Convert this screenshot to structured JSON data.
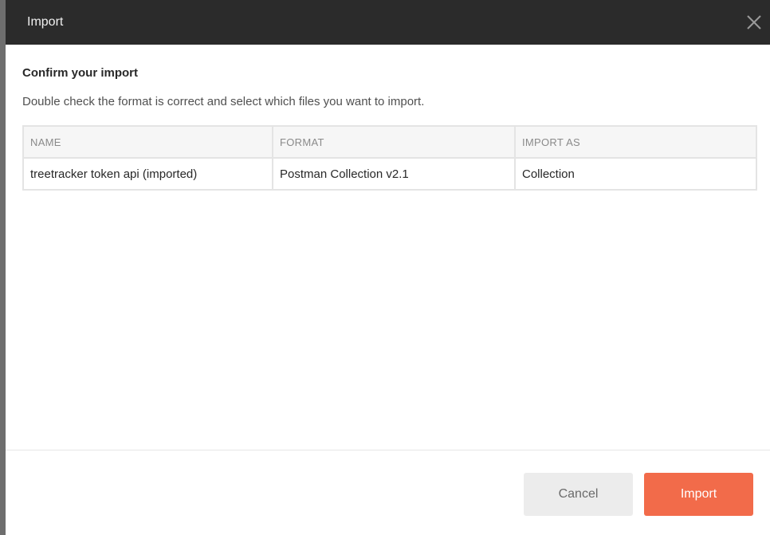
{
  "dialog": {
    "title": "Import",
    "close_icon": "close-icon"
  },
  "confirm": {
    "title": "Confirm your import",
    "description": "Double check the format is correct and select which files you want to import."
  },
  "table": {
    "headers": [
      "NAME",
      "FORMAT",
      "IMPORT AS"
    ],
    "rows": [
      [
        "treetracker token api (imported)",
        "Postman Collection v2.1",
        "Collection"
      ]
    ]
  },
  "footer": {
    "cancel_label": "Cancel",
    "import_label": "Import"
  },
  "colors": {
    "header_bg": "#2b2b2b",
    "accent": "#f26b4a",
    "cancel_bg": "#ececec"
  }
}
